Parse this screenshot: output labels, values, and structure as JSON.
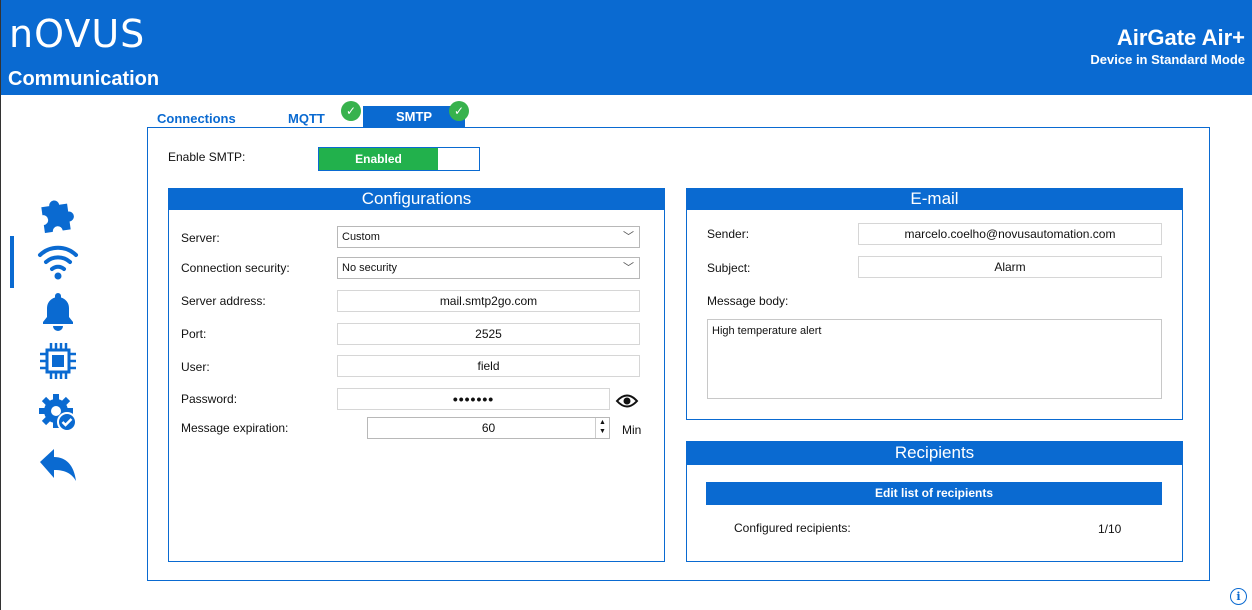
{
  "header": {
    "logo": "nOVUS",
    "title": "Communication",
    "device_name": "AirGate Air+",
    "device_mode": "Device in Standard Mode"
  },
  "sidebar": {
    "items": [
      {
        "icon": "puzzle-icon"
      },
      {
        "icon": "wifi-icon",
        "active": true
      },
      {
        "icon": "bell-icon"
      },
      {
        "icon": "chip-icon"
      },
      {
        "icon": "gear-check-icon"
      },
      {
        "icon": "back-arrow-icon"
      }
    ]
  },
  "tabs": [
    {
      "label": "Connections",
      "checked": false
    },
    {
      "label": "MQTT",
      "checked": true
    },
    {
      "label": "SMTP",
      "checked": true,
      "active": true
    }
  ],
  "smtp": {
    "enable_label": "Enable SMTP:",
    "enable_value": "Enabled"
  },
  "configurations": {
    "title": "Configurations",
    "server_label": "Server:",
    "server_value": "Custom",
    "security_label": "Connection security:",
    "security_value": "No security",
    "address_label": "Server address:",
    "address_value": "mail.smtp2go.com",
    "port_label": "Port:",
    "port_value": "2525",
    "user_label": "User:",
    "user_value": "field",
    "password_label": "Password:",
    "password_value": "•••••••",
    "expiration_label": "Message expiration:",
    "expiration_value": "60",
    "expiration_unit": "Min"
  },
  "email": {
    "title": "E-mail",
    "sender_label": "Sender:",
    "sender_value": "marcelo.coelho@novusautomation.com",
    "subject_label": "Subject:",
    "subject_value": "Alarm",
    "body_label": "Message body:",
    "body_value": "High temperature alert"
  },
  "recipients": {
    "title": "Recipients",
    "edit_button": "Edit list of recipients",
    "configured_label": "Configured recipients:",
    "configured_value": "1/10"
  },
  "colors": {
    "brand": "#0a6ad1",
    "enabled": "#22b14c",
    "check": "#37b24d"
  }
}
